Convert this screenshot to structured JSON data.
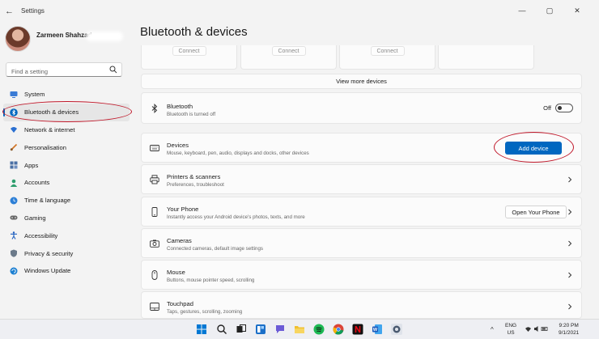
{
  "window": {
    "title": "Settings",
    "controls": {
      "minimize": "—",
      "maximize": "▢",
      "close": "✕"
    }
  },
  "user": {
    "name": "Zarmeen Shahzad"
  },
  "search": {
    "placeholder": "Find a setting"
  },
  "sidebar": {
    "items": [
      {
        "label": "System",
        "icon": "monitor-icon",
        "color": "#3a7bd5"
      },
      {
        "label": "Bluetooth & devices",
        "icon": "bluetooth-icon",
        "color": "#0067c0",
        "active": true
      },
      {
        "label": "Network & internet",
        "icon": "wifi-icon",
        "color": "#2a6fd1"
      },
      {
        "label": "Personalisation",
        "icon": "brush-icon",
        "color": "#d2782b"
      },
      {
        "label": "Apps",
        "icon": "apps-icon",
        "color": "#4a6fa5"
      },
      {
        "label": "Accounts",
        "icon": "person-icon",
        "color": "#2f9e6e"
      },
      {
        "label": "Time & language",
        "icon": "globe-clock-icon",
        "color": "#2c7fd6"
      },
      {
        "label": "Gaming",
        "icon": "gamepad-icon",
        "color": "#666666"
      },
      {
        "label": "Accessibility",
        "icon": "accessibility-icon",
        "color": "#1f5fbf"
      },
      {
        "label": "Privacy & security",
        "icon": "shield-icon",
        "color": "#6b7a8a"
      },
      {
        "label": "Windows Update",
        "icon": "update-icon",
        "color": "#1b7fd1"
      }
    ]
  },
  "main": {
    "title": "Bluetooth & devices",
    "connect_label": "Connect",
    "view_more": "View more devices",
    "bluetooth": {
      "title": "Bluetooth",
      "subtitle": "Bluetooth is turned off",
      "toggle_state": "Off"
    },
    "devices": {
      "title": "Devices",
      "subtitle": "Mouse, keyboard, pen, audio, displays and docks, other devices",
      "button": "Add device"
    },
    "printers": {
      "title": "Printers & scanners",
      "subtitle": "Preferences, troubleshoot"
    },
    "phone": {
      "title": "Your Phone",
      "subtitle": "Instantly access your Android device's photos, texts, and more",
      "button": "Open Your Phone"
    },
    "cameras": {
      "title": "Cameras",
      "subtitle": "Connected cameras, default image settings"
    },
    "mouse": {
      "title": "Mouse",
      "subtitle": "Buttons, mouse pointer speed, scrolling"
    },
    "touchpad": {
      "title": "Touchpad",
      "subtitle": "Taps, gestures, scrolling, zooming"
    }
  },
  "taskbar": {
    "apps": [
      "windows-start-icon",
      "search-icon",
      "task-view-icon",
      "widgets-icon",
      "chat-icon",
      "file-explorer-icon",
      "spotify-icon",
      "chrome-icon",
      "netflix-icon",
      "word-icon",
      "settings-icon"
    ],
    "tray": {
      "chevron": "^",
      "lang_top": "ENG",
      "lang_bottom": "US",
      "time": "9:20 PM",
      "date": "9/1/2021"
    }
  },
  "colors": {
    "accent": "#0067c0",
    "annotation": "#c0182a"
  }
}
